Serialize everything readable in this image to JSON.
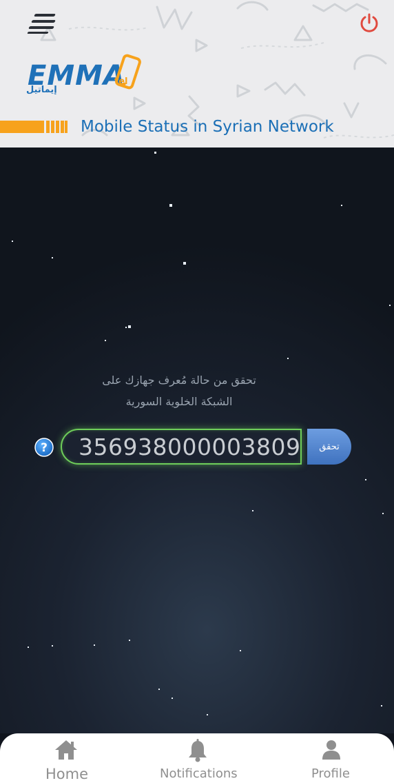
{
  "header": {
    "logo_text": "EMMA",
    "logo_sup": "tel",
    "logo_arabic": "إيماتيل",
    "title": "Mobile Status in Syrian Network",
    "menu_icon": "hamburger-menu-icon",
    "power_icon": "power-icon",
    "colors": {
      "brand_blue": "#1b6fb6",
      "accent_orange": "#f7a21c",
      "power_red": "#e04a3f"
    }
  },
  "main": {
    "instruction_line1": "تحقق من حالة مُعرف جهازك على",
    "instruction_line2": "الشبكة الخلوية السورية",
    "imei_value": "356938000003809",
    "check_label": "تحقق",
    "help_icon": "help-question-icon",
    "colors": {
      "input_glow": "#6fce5a",
      "check_button": "#4f82cc"
    }
  },
  "bottom_nav": {
    "items": [
      {
        "label": "Home",
        "icon": "home-icon"
      },
      {
        "label": "Notifications",
        "icon": "bell-icon"
      },
      {
        "label": "Profile",
        "icon": "user-icon"
      }
    ]
  }
}
